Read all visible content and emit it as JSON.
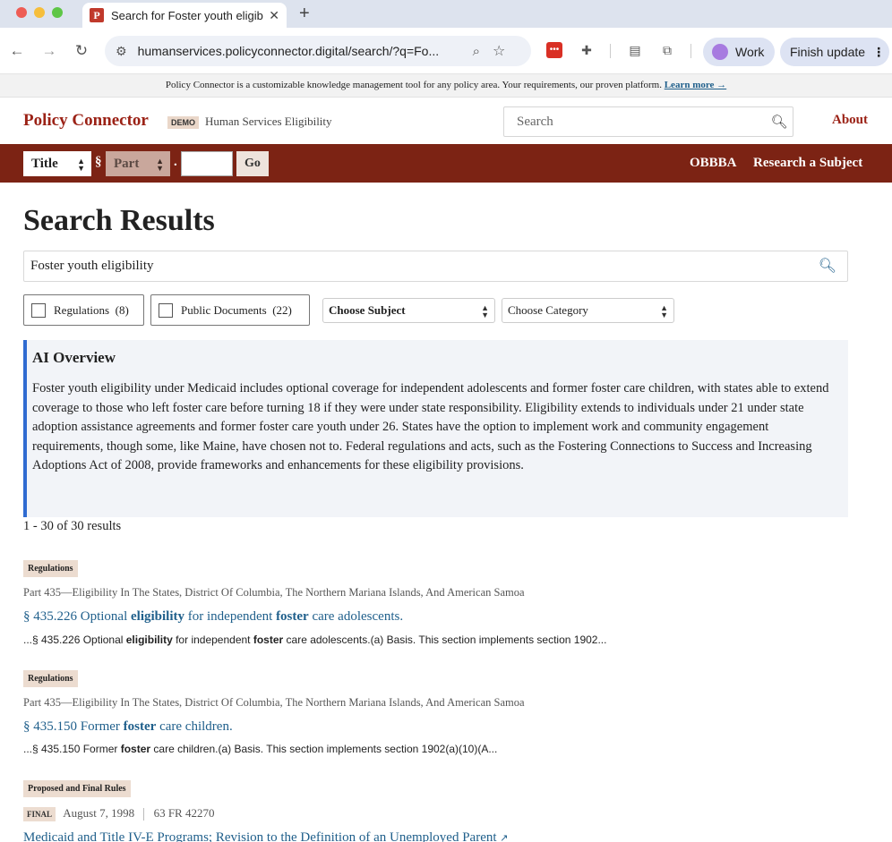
{
  "browser": {
    "tab_title": "Search for Foster youth eligib",
    "favicon_letter": "P",
    "url": "humanservices.policyconnector.digital/search/?q=Fo...",
    "profile_label": "Work",
    "update_label": "Finish update"
  },
  "promo": {
    "text": "Policy Connector is a customizable knowledge management tool for any policy area. Your requirements, our proven platform.",
    "link": "Learn more →"
  },
  "header": {
    "brand": "Policy Connector",
    "demo_badge": "DEMO",
    "subtitle": "Human Services Eligibility",
    "search_placeholder": "Search",
    "about": "About"
  },
  "navbar": {
    "title_select": "Title",
    "section_symbol": "§",
    "part_select": "Part",
    "dot": ".",
    "go": "Go",
    "links": [
      "OBBBA",
      "Research a Subject"
    ]
  },
  "main": {
    "page_title": "Search Results",
    "query": "Foster youth eligibility",
    "filters": {
      "regulations": {
        "label": "Regulations",
        "count": "(8)"
      },
      "public_documents": {
        "label": "Public Documents",
        "count": "(22)"
      },
      "subject": "Choose Subject",
      "category": "Choose Category"
    },
    "ai_overview": {
      "title": "AI Overview",
      "text": "Foster youth eligibility under Medicaid includes optional coverage for independent adolescents and former foster care children, with states able to extend coverage to those who left foster care before turning 18 if they were under state responsibility. Eligibility extends to individuals under 21 under state adoption assistance agreements and former foster care youth under 26. States have the option to implement work and community engagement requirements, though some, like Maine, have chosen not to. Federal regulations and acts, such as the Fostering Connections to Success and Increasing Adoptions Act of 2008, provide frameworks and enhancements for these eligibility provisions."
    },
    "results_count": "1 - 30 of 30 results",
    "results": [
      {
        "badge": "Regulations",
        "part": "Part 435—Eligibility In The States, District Of Columbia, The Northern Mariana Islands, And American Samoa",
        "link_1": "§ 435.226 Optional ",
        "link_2": "eligibility",
        "link_3": " for independent ",
        "link_4": "foster",
        "link_5": " care adolescents.",
        "snip_1": "...§ 435.226 Optional ",
        "snip_2": "eligibility",
        "snip_3": " for independent ",
        "snip_4": "foster",
        "snip_5": " care adolescents.(a) Basis. This section implements section 1902..."
      },
      {
        "badge": "Regulations",
        "part": "Part 435—Eligibility In The States, District Of Columbia, The Northern Mariana Islands, And American Samoa",
        "link_1": "§ 435.150 Former ",
        "link_2": "foster",
        "link_3": " care children.",
        "snip_1": "...§ 435.150 Former ",
        "snip_2": "foster",
        "snip_3": " care children.(a) Basis. This section implements section 1902(a)(10)(A..."
      },
      {
        "badge": "Proposed and Final Rules",
        "status": "FINAL",
        "date": "August 7, 1998",
        "citation": "63 FR 42270",
        "link": "Medicaid and Title IV-E Programs; Revision to the Definition of an Unemployed Parent"
      }
    ]
  }
}
